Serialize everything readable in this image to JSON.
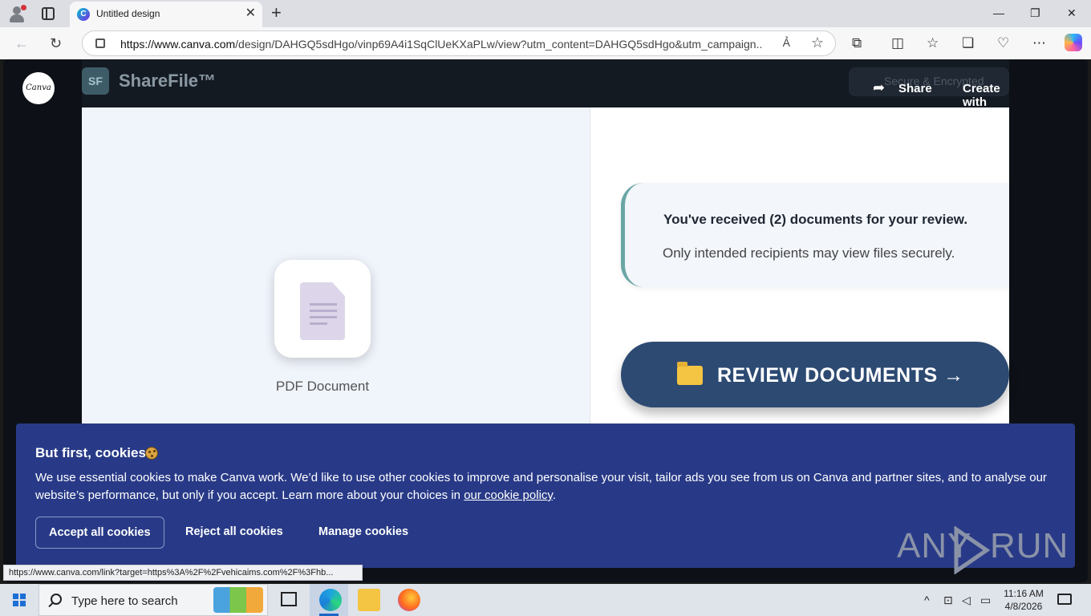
{
  "browser": {
    "tab_title": "Untitled design",
    "url_host": "https://www.canva.com",
    "url_rest": "/design/DAHGQ5sdHgo/vinp69A4i1SqClUeKXaPLw/view?utm_content=DAHGQ5sdHgo&utm_campaign...",
    "read_aloud_label": "Ả"
  },
  "canva": {
    "logo_text": "Canva",
    "share_label": "Share",
    "create_label": "Create with Canva"
  },
  "design": {
    "brand_badge": "SF",
    "brand_name": "ShareFile™",
    "secure_label": "Secure & Encrypted",
    "doc_label": "PDF Document",
    "notice_line1": "You've received (2) documents for your review.",
    "notice_line2": "Only intended recipients may view files securely.",
    "review_button": "REVIEW DOCUMENTS →",
    "colors": {
      "button": "#2d4a72",
      "accent": "#6aa6a6"
    }
  },
  "cookies": {
    "title": "But first, cookies",
    "body_before_link": "We use essential cookies to make Canva work. We’d like to use other cookies to improve and personalise your visit, tailor ads you see from us on Canva and partner sites, and to analyse our website’s performance, but only if you accept. Learn more about your choices in ",
    "link_text": "our cookie policy",
    "body_after_link": ".",
    "accept_label": "Accept all cookies",
    "reject_label": "Reject all cookies",
    "manage_label": "Manage cookies",
    "banner_color": "#283a87"
  },
  "watermark": {
    "left": "ANY",
    "right": "RUN"
  },
  "status_url": "https://www.canva.com/link?target=https%3A%2F%2Fvehicaims.com%2F%3Fhb...",
  "taskbar": {
    "search_placeholder": "Type here to search",
    "time": "11:16 AM",
    "date": "4/8/2026"
  }
}
